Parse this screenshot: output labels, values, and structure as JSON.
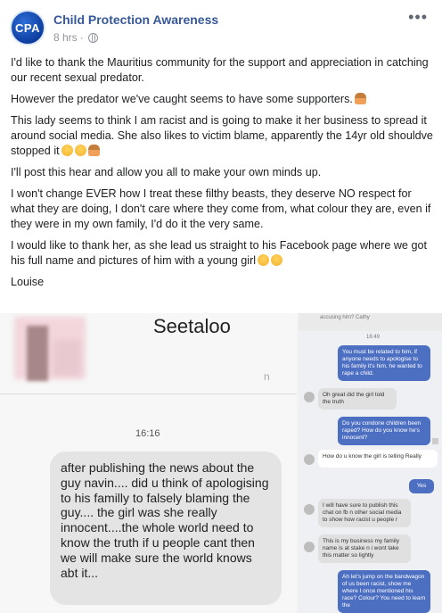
{
  "post": {
    "page_name": "Child Protection Awareness",
    "avatar_text": "CPA",
    "time": "8 hrs",
    "separator": "·",
    "paragraphs": [
      "I'd like to thank the Mauritius community for the support and appreciation in catching our recent sexual predator.",
      "However the predator we've caught seems to have some supporters.",
      "This lady seems to think I am racist and is going to make it her business to spread it around social media. She also likes to victim blame, apparently the 14yr old shouldve stopped it",
      "I'll post this hear and allow you all to make your own minds up.",
      "I won't change EVER how I treat these filthy beasts, they deserve NO respect for what they are doing, I don't care where they come from, what colour they are, even if they were in my own family, I'd do it the very same.",
      "I would like to thank her, as she lead us straight to his Facebook page where we got his full name and pictures of him with a young girl",
      "Louise"
    ]
  },
  "screenshot_left": {
    "contact_name": "Seetaloo",
    "faint_char": "n",
    "time": "16:16",
    "message": "after publishing the news about the guy navin.... did u think of apologising to his familly to falsely blaming the guy.... the girl was she really innocent....the whole world need to know the truth if u people cant then we will make sure the world knows abt it..."
  },
  "screenshot_right": {
    "top_text": "accusing him? Cathy",
    "time": "16:49",
    "messages": [
      "You must be related to him, if anyone needs to apologise to his family it's him, he wanted to rape a child.",
      "Oh great did the girl told the truth",
      "Do you condone  children been raped? How do you know he's innocent?",
      "How do u know the girl is telling Really",
      "Yes",
      "I will have sure to publish this chat on fb n other social media to show how racist u people r",
      "This is my business my family name is at stake n i wont take this matter so lightly",
      "Ah let's jump on the bandwagon of us been racist, show me where I once mentioned his race? Colour? You need to learn the"
    ]
  },
  "colors": {
    "page_name": "#365899",
    "meta": "#90949c",
    "outgoing_bubble": "#4d6fc2",
    "incoming_bubble": "#e0e0e0"
  }
}
